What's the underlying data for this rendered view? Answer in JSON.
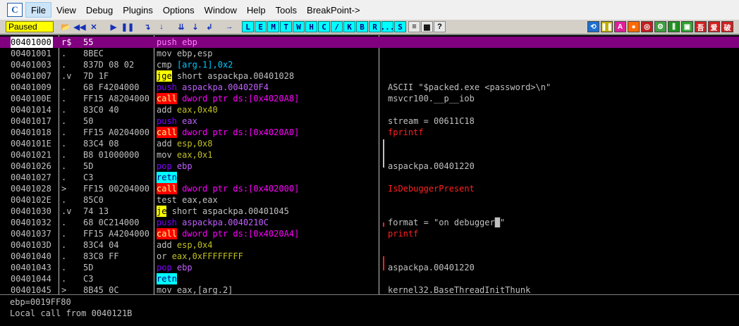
{
  "menubar": {
    "app_icon": "C",
    "items": [
      "File",
      "View",
      "Debug",
      "Plugins",
      "Options",
      "Window",
      "Help",
      "Tools",
      "BreakPoint->"
    ]
  },
  "toolbar": {
    "status": "Paused",
    "nav_buttons": [
      {
        "icon": "folder-open-icon",
        "glyph": "📂"
      },
      {
        "icon": "rewind-icon",
        "glyph": "◀◀"
      },
      {
        "icon": "close-x-icon",
        "glyph": "✕"
      },
      {
        "icon": "run-icon",
        "glyph": "▶"
      },
      {
        "icon": "pause-icon",
        "glyph": "❚❚"
      },
      {
        "icon": "step-into-icon",
        "glyph": "↴"
      },
      {
        "icon": "step-over-icon",
        "glyph": "↓"
      },
      {
        "icon": "trace-into-icon",
        "glyph": "⇊"
      },
      {
        "icon": "trace-over-icon",
        "glyph": "⇣"
      },
      {
        "icon": "execute-till-return-icon",
        "glyph": "↲"
      },
      {
        "icon": "go-to-icon",
        "glyph": "→"
      }
    ],
    "window_buttons": [
      "L",
      "E",
      "M",
      "T",
      "W",
      "H",
      "C",
      "/",
      "K",
      "B",
      "R",
      "...",
      "S"
    ],
    "extra_buttons": [
      {
        "icon": "list-icon",
        "glyph": "≡"
      },
      {
        "icon": "grid-icon",
        "glyph": "▦"
      },
      {
        "icon": "help-icon",
        "glyph": "?"
      }
    ],
    "right_buttons": [
      {
        "icon": "refresh-icon",
        "glyph": "⟲",
        "color": "#1e6fd0"
      },
      {
        "icon": "plugin-pause-icon",
        "glyph": "❚❚",
        "color": "#c0b000"
      },
      {
        "icon": "a-icon",
        "glyph": "A",
        "color": "#e0209a"
      },
      {
        "icon": "circle-icon",
        "glyph": "●",
        "color": "#ff6a00"
      },
      {
        "icon": "target-icon",
        "glyph": "◎",
        "color": "#c02020"
      },
      {
        "icon": "settings-icon",
        "glyph": "⚙",
        "color": "#40a040"
      },
      {
        "icon": "sliders-icon",
        "glyph": "⫼",
        "color": "#209020"
      },
      {
        "icon": "window-icon",
        "glyph": "▣",
        "color": "#30a030"
      },
      {
        "icon": "language-icon",
        "glyph": "吾",
        "color": "#d02020"
      },
      {
        "icon": "love-icon",
        "glyph": "爱",
        "color": "#d02020"
      },
      {
        "icon": "crack-icon",
        "glyph": "破",
        "color": "#d02020"
      }
    ]
  },
  "disasm": [
    {
      "addr": "00401000",
      "mark": "r$",
      "hex": "55",
      "op": "push",
      "args": "ebp",
      "kind": "push",
      "comment": "",
      "selected": true
    },
    {
      "addr": "00401001",
      "mark": ".",
      "hex": "8BEC",
      "op": "mov",
      "args": "ebp,esp",
      "kind": "norm",
      "comment": ""
    },
    {
      "addr": "00401003",
      "mark": ".",
      "hex": "837D 08 02",
      "op": "cmp",
      "args": "[arg.1],0x2",
      "kind": "cmp",
      "comment": ""
    },
    {
      "addr": "00401007",
      "mark": ".v",
      "hex": "7D 1F",
      "op": "jge",
      "args": "short aspackpa.00401028",
      "kind": "jcc",
      "comment": ""
    },
    {
      "addr": "00401009",
      "mark": ".",
      "hex": "68 F4204000",
      "op": "push",
      "args": "aspackpa.004020F4",
      "kind": "push",
      "comment": "ASCII \"$packed.exe <password>\\n\""
    },
    {
      "addr": "0040100E",
      "mark": ".",
      "hex": "FF15 A8204000",
      "op": "call",
      "args": "dword ptr ds:[0x4020A8]",
      "kind": "call",
      "comment": "msvcr100.__p__iob"
    },
    {
      "addr": "00401014",
      "mark": ".",
      "hex": "83C0 40",
      "op": "add",
      "args": "eax,0x40",
      "kind": "imm",
      "comment": ""
    },
    {
      "addr": "00401017",
      "mark": ".",
      "hex": "50",
      "op": "push",
      "args": "eax",
      "kind": "push",
      "comment": "stream = 00611C18"
    },
    {
      "addr": "00401018",
      "mark": ".",
      "hex": "FF15 A0204000",
      "op": "call",
      "args": "dword ptr ds:[0x4020A0]",
      "kind": "call",
      "comment": "fprintf",
      "comment_red": true
    },
    {
      "addr": "0040101E",
      "mark": ".",
      "hex": "83C4 08",
      "op": "add",
      "args": "esp,0x8",
      "kind": "imm",
      "comment": ""
    },
    {
      "addr": "00401021",
      "mark": ".",
      "hex": "B8 01000000",
      "op": "mov",
      "args": "eax,0x1",
      "kind": "imm",
      "comment": ""
    },
    {
      "addr": "00401026",
      "mark": ".",
      "hex": "5D",
      "op": "pop",
      "args": "ebp",
      "kind": "pop",
      "comment": "aspackpa.00401220"
    },
    {
      "addr": "00401027",
      "mark": ".",
      "hex": "C3",
      "op": "retn",
      "args": "",
      "kind": "retn",
      "comment": ""
    },
    {
      "addr": "00401028",
      "mark": ">",
      "hex": "FF15 00204000",
      "op": "call",
      "args": "dword ptr ds:[0x402000]",
      "kind": "call",
      "comment": "IsDebuggerPresent",
      "comment_red": true
    },
    {
      "addr": "0040102E",
      "mark": ".",
      "hex": "85C0",
      "op": "test",
      "args": "eax,eax",
      "kind": "norm",
      "comment": ""
    },
    {
      "addr": "00401030",
      "mark": ".v",
      "hex": "74 13",
      "op": "je",
      "args": "short aspackpa.00401045",
      "kind": "jcc",
      "comment": ""
    },
    {
      "addr": "00401032",
      "mark": ".",
      "hex": "68 0C214000",
      "op": "push",
      "args": "aspackpa.0040210C",
      "kind": "push",
      "comment": "format = \"on debugger█\""
    },
    {
      "addr": "00401037",
      "mark": ".",
      "hex": "FF15 A4204000",
      "op": "call",
      "args": "dword ptr ds:[0x4020A4]",
      "kind": "call",
      "comment": "printf",
      "comment_red": true
    },
    {
      "addr": "0040103D",
      "mark": ".",
      "hex": "83C4 04",
      "op": "add",
      "args": "esp,0x4",
      "kind": "imm",
      "comment": ""
    },
    {
      "addr": "00401040",
      "mark": ".",
      "hex": "83C8 FF",
      "op": "or",
      "args": "eax,0xFFFFFFFF",
      "kind": "imm",
      "comment": ""
    },
    {
      "addr": "00401043",
      "mark": ".",
      "hex": "5D",
      "op": "pop",
      "args": "ebp",
      "kind": "pop",
      "comment": "aspackpa.00401220"
    },
    {
      "addr": "00401044",
      "mark": ".",
      "hex": "C3",
      "op": "retn",
      "args": "",
      "kind": "retn",
      "comment": ""
    },
    {
      "addr": "00401045",
      "mark": ">",
      "hex": "8B45 0C",
      "op": "mov",
      "args": "eax,[arg.2]",
      "kind": "norm",
      "comment": "kernel32.BaseThreadInitThunk"
    }
  ],
  "info": {
    "line1": "ebp=0019FF80",
    "line2": "Local call from 0040121B"
  }
}
